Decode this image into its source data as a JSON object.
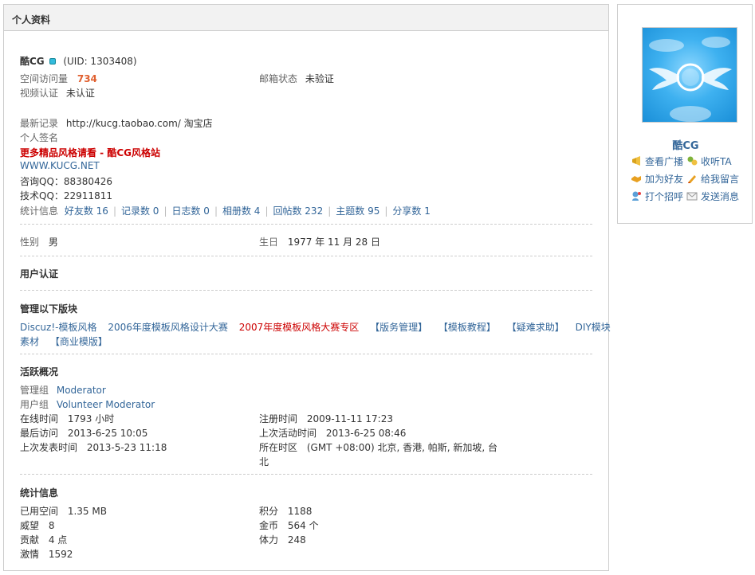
{
  "panel": {
    "title": "个人资料"
  },
  "profile": {
    "username": "酷CG",
    "uid": "(UID: 1303408)",
    "space_visits_label": "空间访问量",
    "space_visits": "734",
    "email_status_label": "邮箱状态",
    "email_status": "未验证",
    "video_auth_label": "视频认证",
    "video_auth": "未认证",
    "latest_label": "最新记录",
    "latest": "http://kucg.taobao.com/ 淘宝店",
    "signature_label": "个人签名",
    "signature_line1": "更多精品风格请看 - 酷CG风格站",
    "signature_line2": "WWW.KUCG.NET",
    "signature_line3": "咨询QQ：88380426",
    "signature_line4": "技术QQ：22911811",
    "stats_label": "统计信息",
    "stats": [
      "好友数 16",
      "记录数 0",
      "日志数 0",
      "相册数 4",
      "回帖数 232",
      "主题数 95",
      "分享数 1"
    ]
  },
  "basic": {
    "gender_label": "性别",
    "gender": "男",
    "birthday_label": "生日",
    "birthday": "1977 年 11 月 28 日"
  },
  "auth": {
    "title": "用户认证"
  },
  "moderated": {
    "title": "管理以下版块",
    "forums_line1": [
      "Discuz!-模板风格",
      "2006年度模板风格设计大赛",
      "2007年度模板风格大赛专区",
      "【版务管理】",
      "【模板教程】",
      "【疑难求助】",
      "DIY模块"
    ],
    "forums_line2": [
      "素材",
      "【商业模版】"
    ]
  },
  "activity": {
    "title": "活跃概况",
    "admin_group_label": "管理组",
    "admin_group": "Moderator",
    "user_group_label": "用户组",
    "user_group": "Volunteer Moderator",
    "online_label": "在线时间",
    "online": "1793 小时",
    "register_label": "注册时间",
    "register": "2009-11-11 17:23",
    "last_visit_label": "最后访问",
    "last_visit": "2013-6-25 10:05",
    "last_active_label": "上次活动时间",
    "last_active": "2013-6-25 08:46",
    "last_post_label": "上次发表时间",
    "last_post": "2013-5-23 11:18",
    "timezone_label": "所在时区",
    "timezone_line1": "(GMT +08:00) 北京, 香港, 帕斯, 新加坡, 台",
    "timezone_line2": "北"
  },
  "statistics": {
    "title": "统计信息",
    "used_space_label": "已用空间",
    "used_space": "1.35 MB",
    "credits_label": "积分",
    "credits": "1188",
    "prestige_label": "威望",
    "prestige": "8",
    "gold_label": "金币",
    "gold": "564 个",
    "contribution_label": "贡献",
    "contribution": "4 点",
    "stamina_label": "体力",
    "stamina": "248",
    "passion_label": "激情",
    "passion": "1592"
  },
  "sidebar": {
    "name": "酷CG",
    "avatar_text": "酷CG",
    "actions": {
      "view_broadcast": "查看广播",
      "follow": "收听TA",
      "add_friend": "加为好友",
      "leave_message": "给我留言",
      "greet": "打个招呼",
      "send_message": "发送消息"
    }
  }
}
